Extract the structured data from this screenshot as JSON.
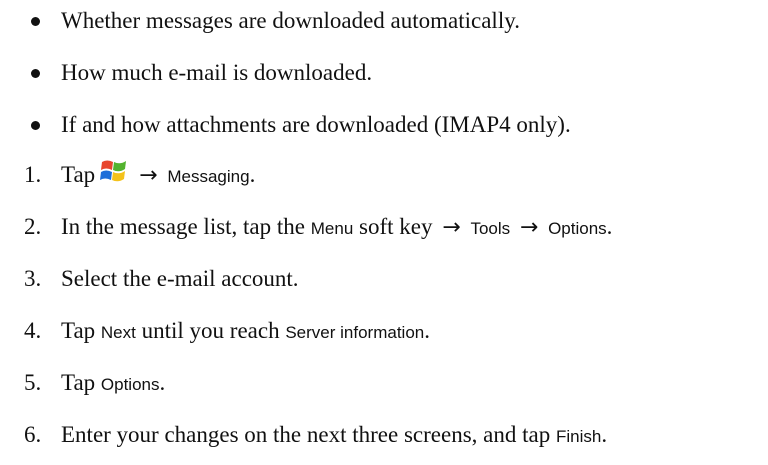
{
  "bullets": [
    "Whether messages are downloaded automatically.",
    "How much e-mail is downloaded.",
    "If and how attachments are downloaded (IMAP4 only)."
  ],
  "steps": [
    {
      "num": "1.",
      "pre": "Tap",
      "arrow": "→",
      "ui": "Messaging",
      "post": "."
    },
    {
      "num": "2.",
      "pre": "In the message list, tap the",
      "ui1": "Menu",
      "mid": "soft key",
      "arrow1": "→",
      "ui2": "Tools",
      "arrow2": "→",
      "ui3": "Options",
      "post": "."
    },
    {
      "num": "3.",
      "text": "Select the e-mail account."
    },
    {
      "num": "4.",
      "pre": "Tap",
      "ui1": "Next",
      "mid": "until you reach",
      "ui2": "Server information",
      "post": "."
    },
    {
      "num": "5.",
      "pre": "Tap",
      "ui": "Options",
      "post": "."
    },
    {
      "num": "6.",
      "pre": "Enter your changes on the next three screens, and tap",
      "ui": "Finish",
      "post": "."
    }
  ],
  "icons": {
    "start": "windows-start-flag-icon"
  },
  "colors": {
    "flag_red": "#e8452c",
    "flag_green": "#53b32e",
    "flag_blue": "#1e6fd9",
    "flag_yellow": "#f4c21b"
  }
}
